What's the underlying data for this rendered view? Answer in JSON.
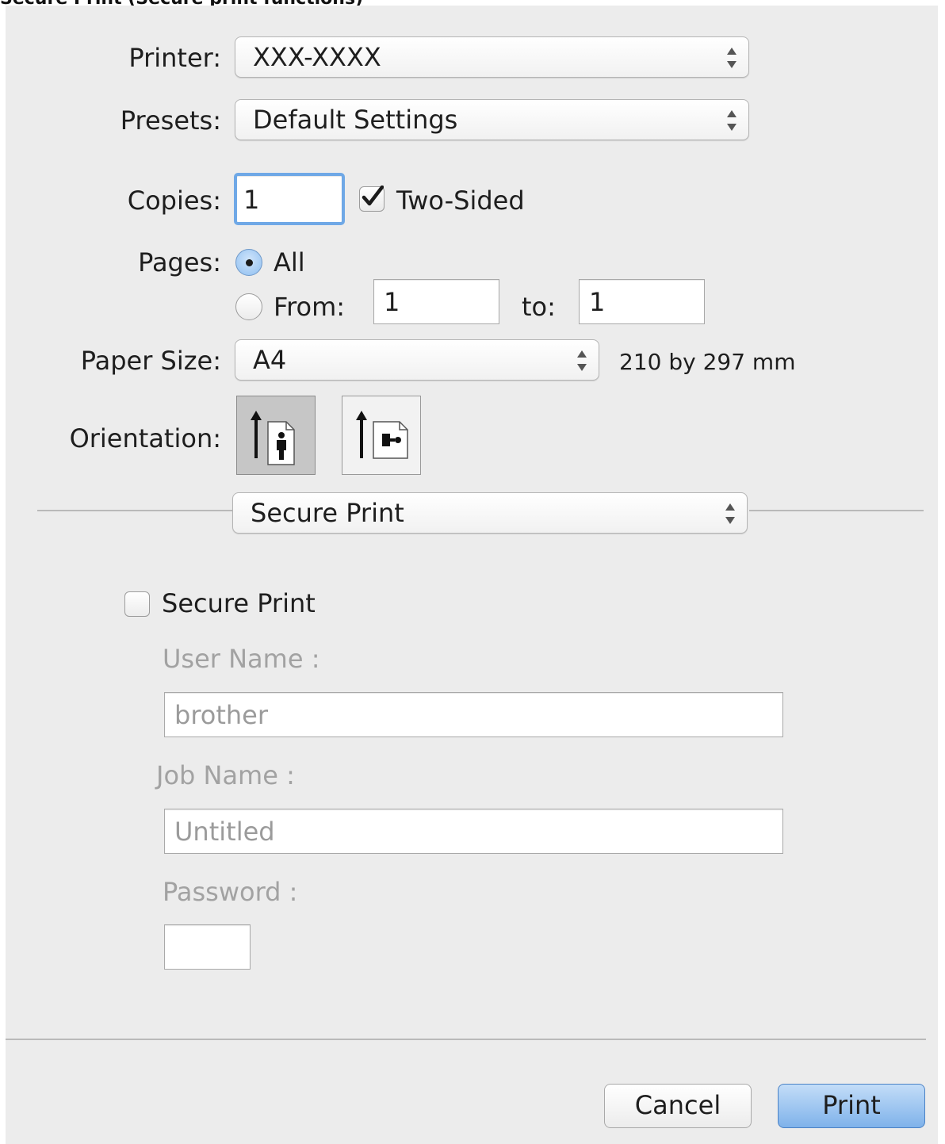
{
  "caption": "Secure Print (Secure print functions)",
  "printer": {
    "label": "Printer:",
    "value": "XXX-XXXX"
  },
  "presets": {
    "label": "Presets:",
    "value": "Default Settings"
  },
  "copies": {
    "label": "Copies:",
    "value": "1",
    "two_sided_label": "Two-Sided",
    "two_sided_checked": true
  },
  "pages": {
    "label": "Pages:",
    "all_label": "All",
    "from_label": "From:",
    "from_value": "1",
    "to_label": "to:",
    "to_value": "1",
    "selected": "All"
  },
  "paper_size": {
    "label": "Paper Size:",
    "value": "A4",
    "dimensions": "210 by 297 mm"
  },
  "orientation": {
    "label": "Orientation:",
    "selected": "portrait"
  },
  "section_menu": {
    "value": "Secure Print"
  },
  "secure_print": {
    "checkbox_label": "Secure Print",
    "checked": false,
    "user_name_label": "User Name :",
    "user_name_value": "brother",
    "job_name_label": "Job Name :",
    "job_name_value": "Untitled",
    "password_label": "Password :",
    "password_value": ""
  },
  "buttons": {
    "cancel": "Cancel",
    "print": "Print"
  },
  "colors": {
    "accent": "#7fb2ea",
    "focus_ring": "#6fa8e6",
    "dialog_bg": "#ececec"
  }
}
